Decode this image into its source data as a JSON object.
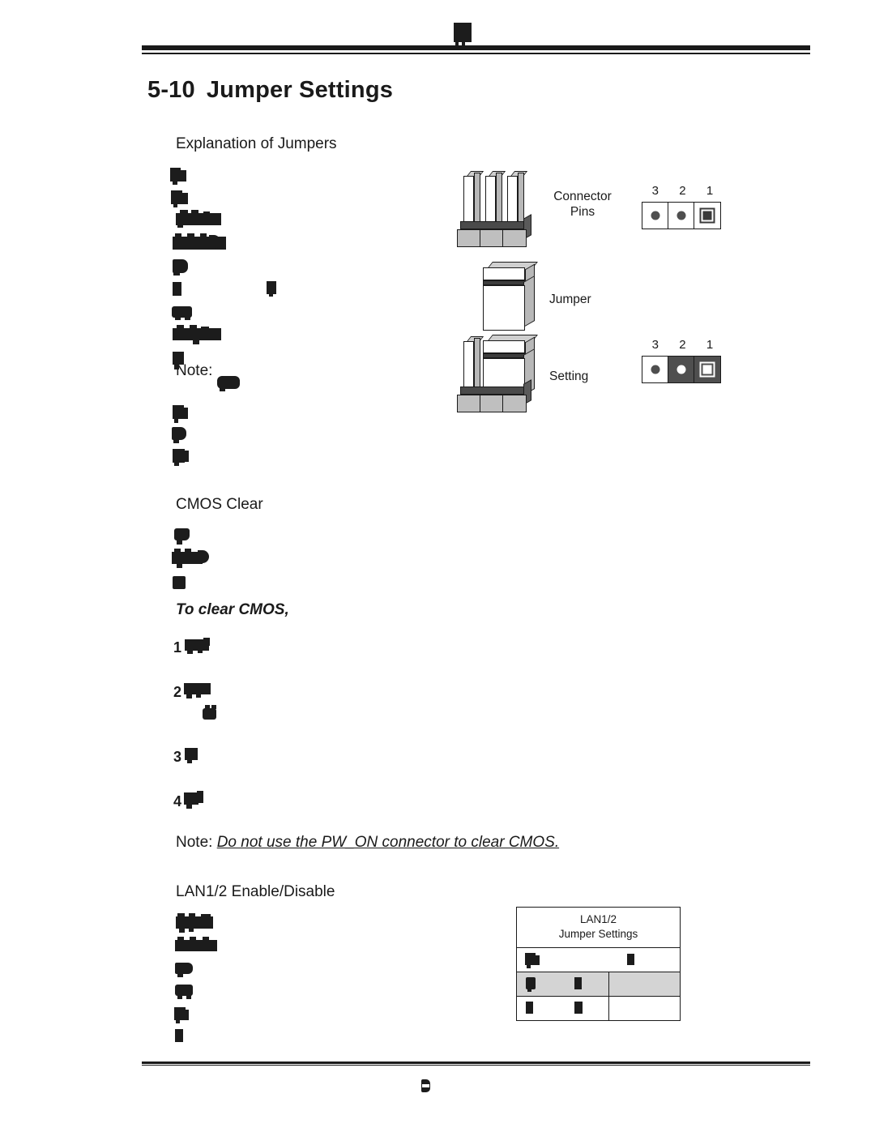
{
  "document": {
    "section_number": "5-10",
    "section_title": "Jumper Settings",
    "page_footer_marker": "■",
    "header_marker": "■"
  },
  "headings": {
    "explanation": "Explanation of Jumpers",
    "cmos_clear": "CMOS Clear",
    "lan_enable_disable": "LAN1/2 Enable/Disable"
  },
  "emphasis": {
    "to_clear_cmos": "To clear CMOS,"
  },
  "notes": {
    "note_label": "Note:",
    "inline_note_label": "Note:",
    "pw_on_note_label": "Note:",
    "pw_on_note_text": "Do not use the PW_ON connector to clear CMOS."
  },
  "list_numbers": {
    "one": "1",
    "two": "2",
    "three": "3",
    "four": "4"
  },
  "diagram": {
    "labels": {
      "connector_pins_line1": "Connector",
      "connector_pins_line2": "Pins",
      "jumper": "Jumper",
      "setting": "Setting"
    },
    "pin_numbers_open": [
      "3",
      "2",
      "1"
    ],
    "pin_numbers_closed": [
      "3",
      "2",
      "1"
    ],
    "open_state": {
      "cells": [
        {
          "pin": "3",
          "filled": false,
          "marker": "dot"
        },
        {
          "pin": "2",
          "filled": false,
          "marker": "dot"
        },
        {
          "pin": "1",
          "filled": false,
          "marker": "square"
        }
      ]
    },
    "closed_state": {
      "cells": [
        {
          "pin": "3",
          "filled": false,
          "marker": "dot"
        },
        {
          "pin": "2",
          "filled": true,
          "marker": "dot-light"
        },
        {
          "pin": "1",
          "filled": true,
          "marker": "square-light"
        }
      ]
    },
    "colors": {
      "pin_face": "#ffffff",
      "pin_side": "#b8b8b8",
      "base_front": "#bfbfbf",
      "base_top": "#4a4a4a",
      "grid_fill": "#4f4f4f",
      "outline": "#1a1a1a"
    }
  },
  "lan_table": {
    "caption_line1": "LAN1/2",
    "caption_line2": "Jumper Settings",
    "shaded_row_color": "#d4d4d4",
    "rows": [
      {
        "type": "header",
        "shaded": false,
        "cells": [
          "",
          ""
        ]
      },
      {
        "type": "data",
        "shaded": true,
        "cells": [
          "",
          "",
          ""
        ]
      },
      {
        "type": "data",
        "shaded": false,
        "cells": [
          "",
          "",
          ""
        ]
      }
    ]
  },
  "body_text_status": "illegible-scan-artifacts"
}
